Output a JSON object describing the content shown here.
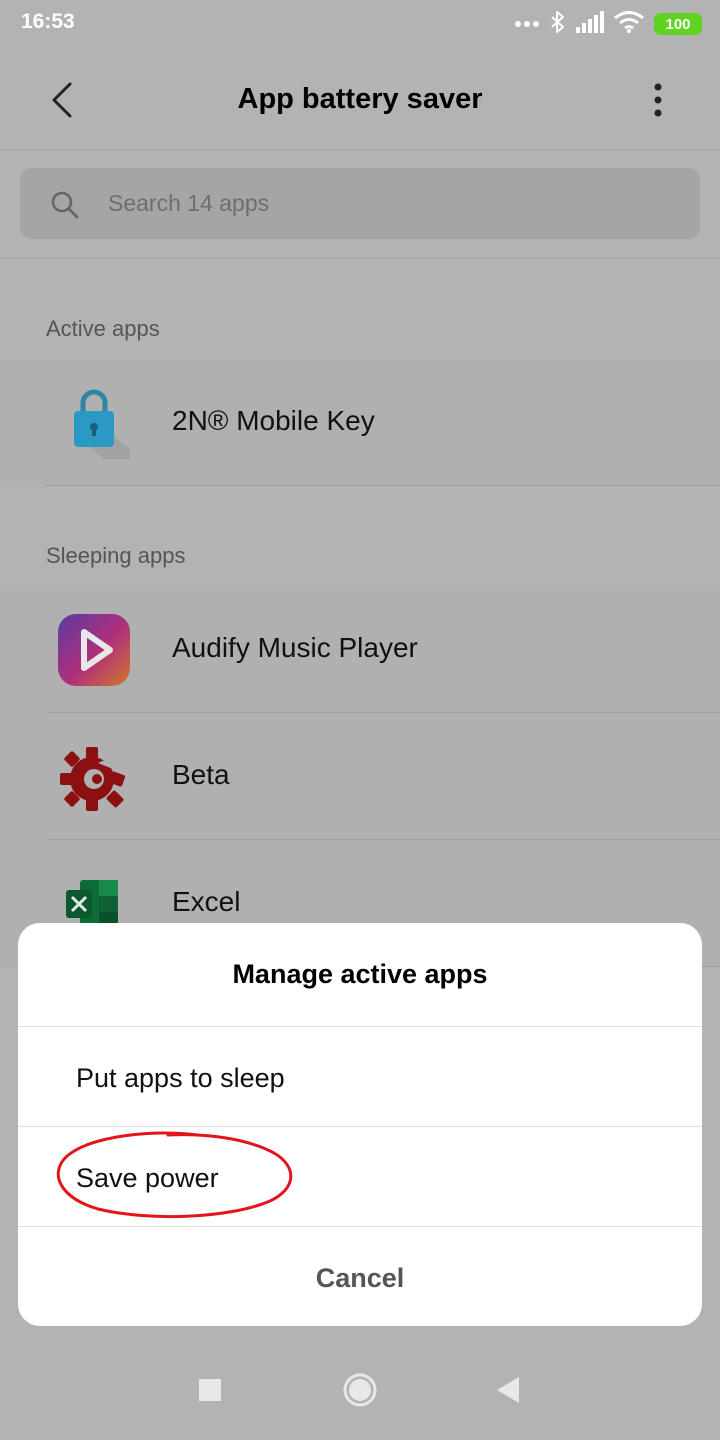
{
  "status_bar": {
    "time": "16:53",
    "battery": "100",
    "icons": [
      "more-dots-icon",
      "bluetooth-icon",
      "signal-icon",
      "wifi-icon",
      "battery-icon"
    ]
  },
  "header": {
    "title": "App battery saver",
    "back_icon": "chevron-left-icon",
    "menu_icon": "more-vertical-icon"
  },
  "search": {
    "placeholder": "Search 14 apps",
    "icon": "search-icon"
  },
  "sections": {
    "active": {
      "label": "Active apps",
      "apps": [
        {
          "name": "2N® Mobile Key",
          "icon": "padlock-icon"
        }
      ]
    },
    "sleeping": {
      "label": "Sleeping apps",
      "apps": [
        {
          "name": "Audify Music Player",
          "icon": "play-icon"
        },
        {
          "name": "Beta",
          "icon": "gear-icon"
        },
        {
          "name": "Excel",
          "icon": "excel-icon"
        }
      ]
    }
  },
  "dialog": {
    "title": "Manage active apps",
    "options": [
      {
        "label": "Put apps to sleep"
      },
      {
        "label": "Save power",
        "highlighted": true
      }
    ],
    "cancel_label": "Cancel"
  },
  "nav_bar": {
    "icons": [
      "recents-icon",
      "home-icon",
      "back-icon"
    ]
  },
  "colors": {
    "battery_green": "#5fd420",
    "dim_overlay": "#b3b3b3",
    "annotation_red": "#e3141b"
  }
}
